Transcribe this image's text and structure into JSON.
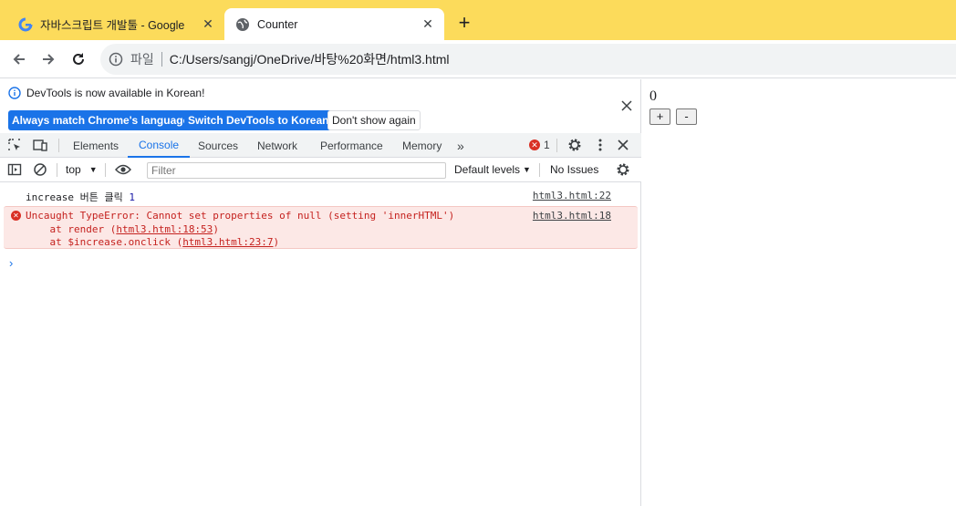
{
  "tabs": [
    {
      "title": "자바스크립트 개발툴 - Google",
      "favicon": "google-icon",
      "active": false
    },
    {
      "title": "Counter",
      "favicon": "globe-icon",
      "active": true
    }
  ],
  "toolbar": {
    "scheme_label": "파일",
    "url": "C:/Users/sangj/OneDrive/바탕%20화면/html3.html"
  },
  "devtools": {
    "infobar": {
      "message": "DevTools is now available in Korean!",
      "btn_match": "Always match Chrome's language",
      "btn_switch": "Switch DevTools to Korean",
      "btn_dismiss": "Don't show again"
    },
    "tabs": [
      "Elements",
      "Console",
      "Sources",
      "Network",
      "Performance",
      "Memory"
    ],
    "active_tab": "Console",
    "error_count": "1",
    "console_toolbar": {
      "context": "top",
      "filter_placeholder": "Filter",
      "levels": "Default levels",
      "issues": "No Issues"
    },
    "log": {
      "text": "increase 버튼 클릭",
      "value": "1",
      "source": "html3.html:22"
    },
    "error": {
      "message": "Uncaught TypeError: Cannot set properties of null (setting 'innerHTML')",
      "source": "html3.html:18",
      "stack1_prefix": "    at render (",
      "stack1_link": "html3.html:18:53",
      "stack1_suffix": ")",
      "stack2_prefix": "    at $increase.onclick (",
      "stack2_link": "html3.html:23:7",
      "stack2_suffix": ")"
    },
    "prompt_symbol": "›"
  },
  "page": {
    "count": "0",
    "plus_label": "+",
    "minus_label": "-"
  },
  "colors": {
    "tabstrip": "#fcdb5b",
    "accent": "#1a73e8",
    "error": "#d93025"
  }
}
